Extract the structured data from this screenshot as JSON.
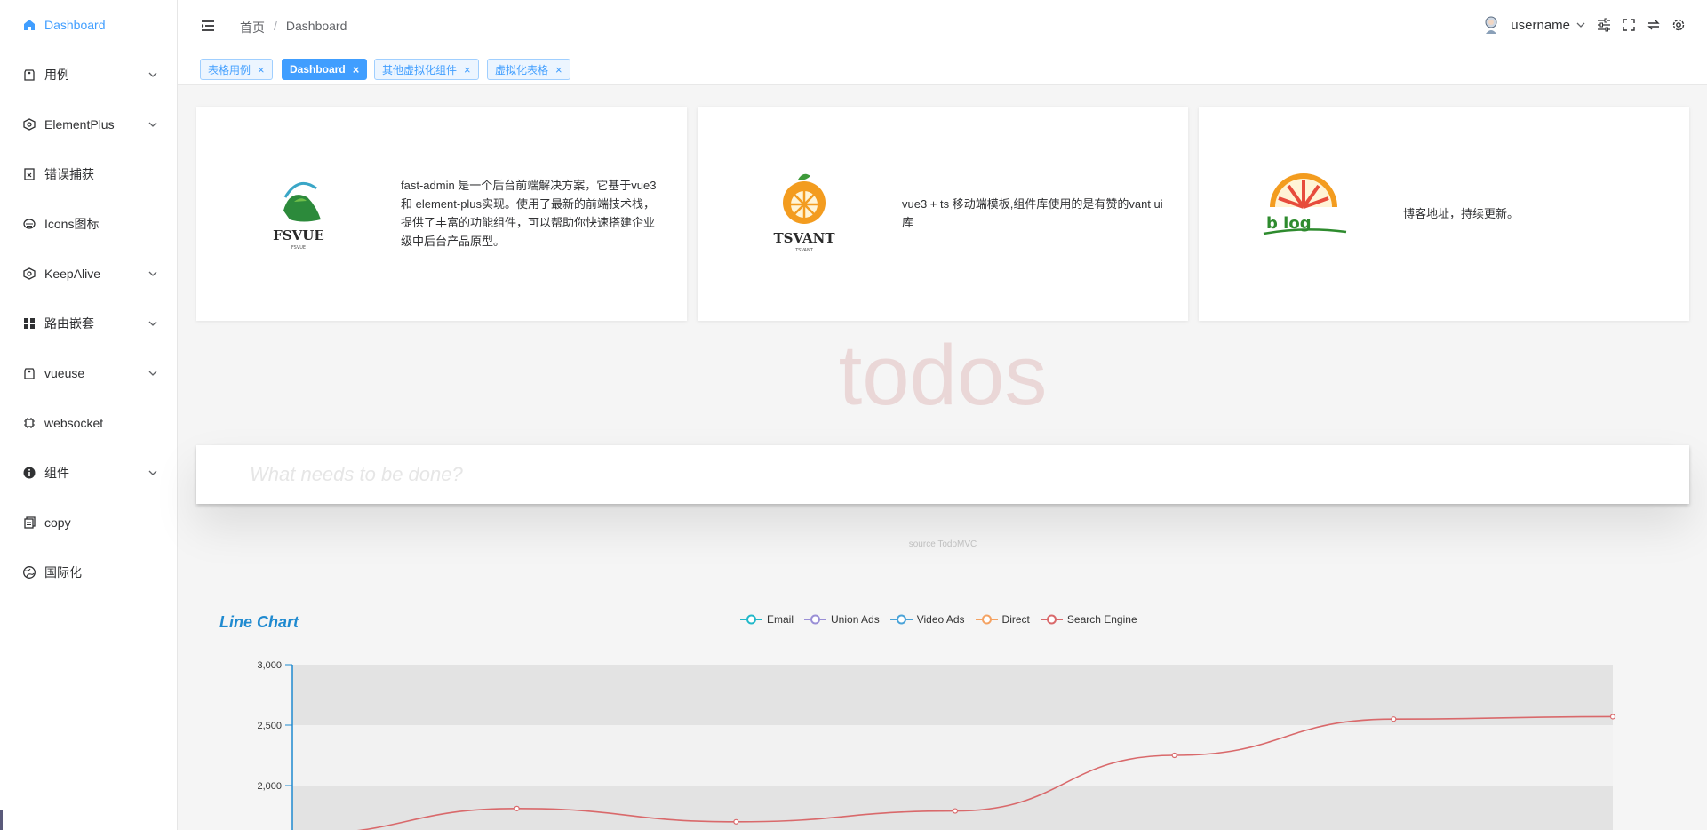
{
  "sidebar": {
    "items": [
      {
        "label": "Dashboard",
        "icon": "home-icon",
        "active": true,
        "has_children": false
      },
      {
        "label": "用例",
        "icon": "tag-icon",
        "active": false,
        "has_children": true
      },
      {
        "label": "ElementPlus",
        "icon": "element-icon",
        "active": false,
        "has_children": true
      },
      {
        "label": "错误捕获",
        "icon": "document-x-icon",
        "active": false,
        "has_children": false
      },
      {
        "label": "Icons图标",
        "icon": "cloud-icon",
        "active": false,
        "has_children": false
      },
      {
        "label": "KeepAlive",
        "icon": "element-icon",
        "active": false,
        "has_children": true
      },
      {
        "label": "路由嵌套",
        "icon": "grid-icon",
        "active": false,
        "has_children": true
      },
      {
        "label": "vueuse",
        "icon": "tag-icon",
        "active": false,
        "has_children": true
      },
      {
        "label": "websocket",
        "icon": "chip-icon",
        "active": false,
        "has_children": false
      },
      {
        "label": "组件",
        "icon": "info-icon",
        "active": false,
        "has_children": true
      },
      {
        "label": "copy",
        "icon": "copy-icon",
        "active": false,
        "has_children": false
      },
      {
        "label": "国际化",
        "icon": "globe-icon",
        "active": false,
        "has_children": false
      }
    ]
  },
  "header": {
    "breadcrumb": [
      "首页",
      "Dashboard"
    ],
    "breadcrumb_separator": "/",
    "username": "username"
  },
  "tags": [
    {
      "label": "表格用例",
      "active": false
    },
    {
      "label": "Dashboard",
      "active": true
    },
    {
      "label": "其他虚拟化组件",
      "active": false
    },
    {
      "label": "虚拟化表格",
      "active": false
    }
  ],
  "tag_close": "×",
  "cards": [
    {
      "logo_text": "FSVUE",
      "logo_subtext": "FSVUE",
      "description": "fast-admin 是一个后台前端解决方案，它基于vue3 和 element-plus实现。使用了最新的前端技术栈，提供了丰富的功能组件，可以帮助你快速搭建企业级中后台产品原型。"
    },
    {
      "logo_text": "TSVANT",
      "logo_subtext": "TSVANT",
      "description": "vue3 + ts 移动端模板,组件库使用的是有赞的vant ui 库"
    },
    {
      "logo_text": "b log",
      "description": "博客地址，持续更新。"
    }
  ],
  "todos": {
    "title": "todos",
    "placeholder": "What needs to be done?",
    "source": "source TodoMVC"
  },
  "colors": {
    "accent": "#409eff",
    "email": "#22b8c9",
    "union_ads": "#9a8fd6",
    "video_ads": "#4aa3d8",
    "direct": "#f4a262",
    "search_engine": "#d9696b"
  },
  "chart_data": {
    "type": "line",
    "title": "Line Chart",
    "legend": [
      "Email",
      "Union Ads",
      "Video Ads",
      "Direct",
      "Search Engine"
    ],
    "legend_position": "top-center",
    "y_ticks": [
      "3,000",
      "2,500",
      "2,000"
    ],
    "ylim": [
      1600,
      3000
    ],
    "series": [
      {
        "name": "Search Engine",
        "values": [
          1600,
          1810,
          1700,
          1790,
          2250,
          2550,
          2570
        ]
      }
    ],
    "points_count": 7,
    "grid": "banded"
  }
}
